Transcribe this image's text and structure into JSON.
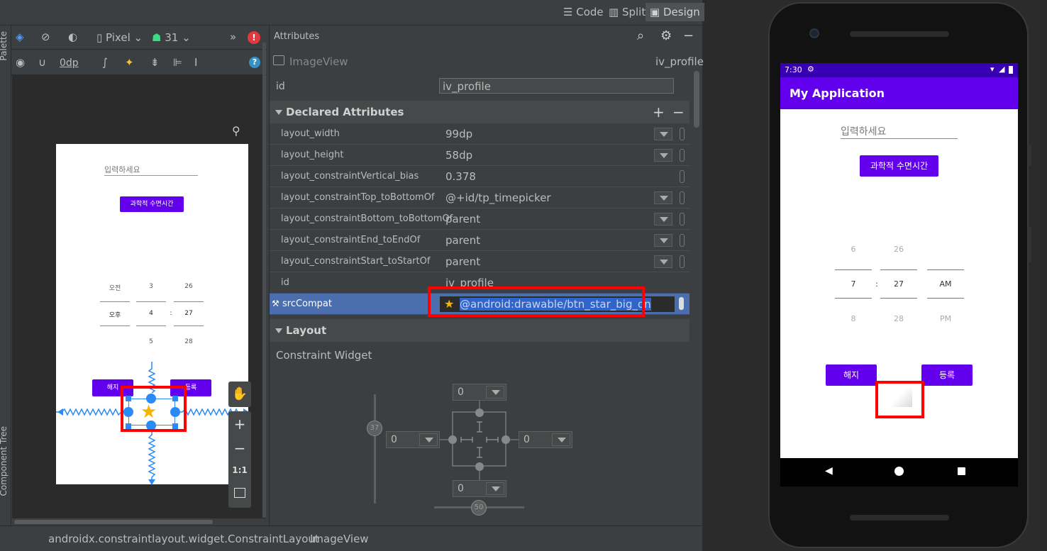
{
  "modes": {
    "code": "Code",
    "split": "Split",
    "design": "Design"
  },
  "designbar": {
    "device": "Pixel",
    "api": "31",
    "margin": "0dp"
  },
  "side_tabs": {
    "palette": "Palette",
    "component_tree": "Component Tree"
  },
  "attributes": {
    "panel_title": "Attributes",
    "widget_type": "ImageView",
    "widget_id": "iv_profile",
    "id_label": "id",
    "id_value": "iv_profile",
    "declared_section": "Declared Attributes",
    "rows": [
      {
        "name": "layout_width",
        "value": "99dp"
      },
      {
        "name": "layout_height",
        "value": "58dp"
      },
      {
        "name": "layout_constraintVertical_bias",
        "value": "0.378"
      },
      {
        "name": "layout_constraintTop_toBottomOf",
        "value": "@+id/tp_timepicker"
      },
      {
        "name": "layout_constraintBottom_toBottomOf",
        "value": "parent"
      },
      {
        "name": "layout_constraintEnd_toEndOf",
        "value": "parent"
      },
      {
        "name": "layout_constraintStart_toStartOf",
        "value": "parent"
      },
      {
        "name": "id",
        "value": "iv_profile"
      },
      {
        "name": "srcCompat",
        "value": "@android:drawable/btn_star_big_on"
      }
    ],
    "layout_section": "Layout",
    "constraint_widget_label": "Constraint Widget",
    "constraint": {
      "top": "0",
      "left": "0",
      "right": "0",
      "bottom": "0",
      "vertical_bias": "37",
      "horizontal_bias": "50"
    }
  },
  "preview": {
    "hint": "입력하세요",
    "button": "과학적 수면시간",
    "ampm_top": "오전",
    "ampm_sel": "오후",
    "hour_top": "3",
    "hour_sel": "4",
    "hour_bot": "5",
    "min_top": "26",
    "min_sel": "27",
    "min_bot": "28",
    "colon": ":",
    "cancel": "해지",
    "register": "등록"
  },
  "zoom": {
    "one_to_one": "1:1"
  },
  "breadcrumb": {
    "parent": "androidx.constraintlayout.widget.ConstraintLayout",
    "child": "ImageView"
  },
  "emulator": {
    "time": "7:30",
    "app_title": "My Application",
    "hint": "입력하세요",
    "button": "과학적 수면시간",
    "hour_top": "6",
    "hour_sel": "7",
    "hour_bot": "8",
    "min_top": "26",
    "min_sel": "27",
    "min_bot": "28",
    "colon": ":",
    "ampm_sel": "AM",
    "ampm_bot": "PM",
    "cancel": "해지",
    "register": "등록"
  },
  "colors": {
    "accent": "#6200ee",
    "highlight": "#ff0000",
    "selection": "#4b6eaf"
  }
}
